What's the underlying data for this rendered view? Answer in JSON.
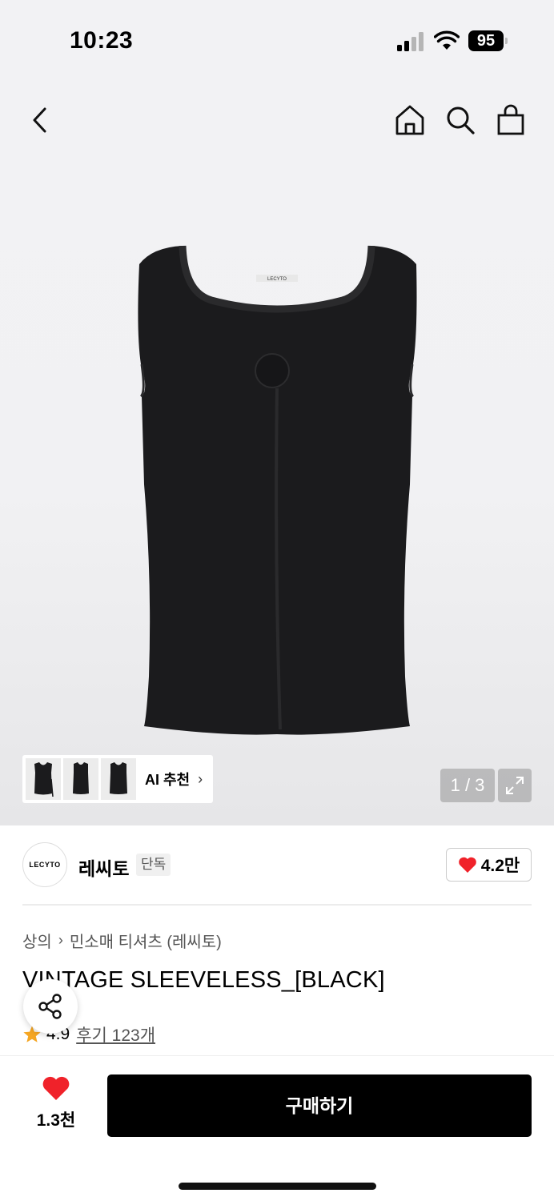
{
  "status_bar": {
    "time": "10:23",
    "battery": "95"
  },
  "nav": {
    "back_icon": "chevron-left-icon",
    "home_icon": "home-icon",
    "search_icon": "search-icon",
    "cart_icon": "shopping-bag-icon"
  },
  "gallery": {
    "ai_recommend_label": "AI 추천",
    "page_counter": "1 / 3",
    "thumbnails": [
      "thumbnail-1",
      "thumbnail-2",
      "thumbnail-3"
    ]
  },
  "brand": {
    "logo_text": "LECYTO",
    "name": "레씨토",
    "exclusive_label": "단독",
    "like_count": "4.2만"
  },
  "breadcrumb": {
    "category": "상의",
    "subcategory": "민소매 티셔츠 (레씨토)"
  },
  "product": {
    "title": "VINTAGE SLEEVELESS_[BLACK]",
    "rating": "4.9",
    "review_label": "후기 123개"
  },
  "bottom_bar": {
    "wish_count": "1.3천",
    "buy_label": "구매하기"
  },
  "colors": {
    "heart": "#f0222a",
    "star": "#f5a623",
    "buy_button": "#000000",
    "garment": "#1b1b1d"
  }
}
